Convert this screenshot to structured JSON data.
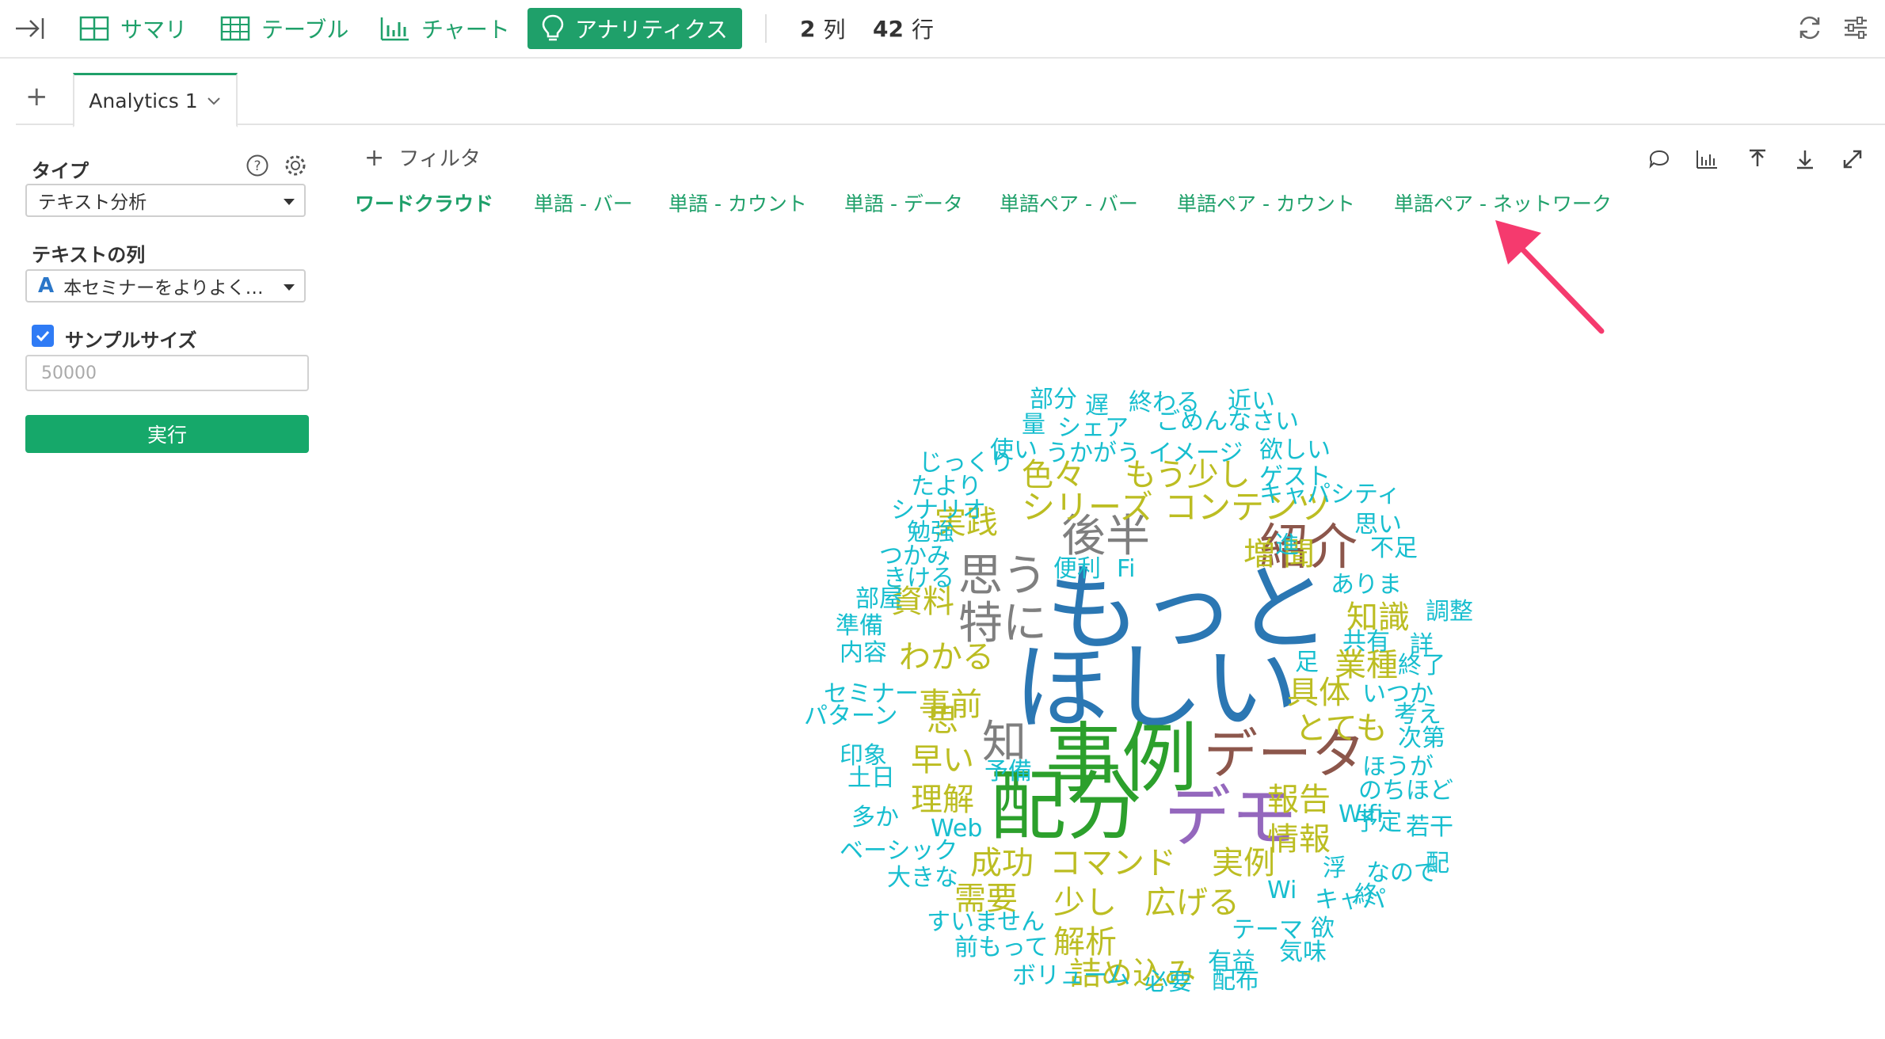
{
  "toolbar": {
    "items": [
      {
        "label": "サマリ",
        "icon": "summary-grid-icon"
      },
      {
        "label": "テーブル",
        "icon": "table-icon"
      },
      {
        "label": "チャート",
        "icon": "bar-chart-icon"
      },
      {
        "label": "アナリティクス",
        "icon": "lightbulb-icon"
      }
    ],
    "columns_count": "2",
    "columns_unit": "列",
    "rows_count": "42",
    "rows_unit": "行"
  },
  "tabs": {
    "add": "+",
    "active_tab": "Analytics 1"
  },
  "panel": {
    "type_label": "タイプ",
    "type_value": "テキスト分析",
    "text_col_label": "テキストの列",
    "text_col_value": "本セミナーをよりよく…",
    "text_col_icon_glyph": "A",
    "sample_label": "サンプルサイズ",
    "sample_placeholder": "50000",
    "run_label": "実行"
  },
  "main": {
    "filter_label": "フィルタ",
    "subtabs": [
      "ワードクラウド",
      "単語 - バー",
      "単語 - カウント",
      "単語 - データ",
      "単語ペア - バー",
      "単語ペア - カウント",
      "単語ペア - ネットワーク"
    ]
  },
  "colors": {
    "accent": "#1fa06a",
    "arrow": "#f53a6e"
  },
  "words": [
    {
      "t": "もっと",
      "c": "#2b77b3",
      "s": 120
    },
    {
      "t": "ほしい",
      "c": "#2b77b3",
      "s": 120
    },
    {
      "t": "事例",
      "c": "#2ca02c",
      "s": 96
    },
    {
      "t": "配分",
      "c": "#2ca02c",
      "s": 96
    },
    {
      "t": "デモ",
      "c": "#9467bd",
      "s": 84
    },
    {
      "t": "データ",
      "c": "#8c564b",
      "s": 68
    },
    {
      "t": "紹介",
      "c": "#8c564b",
      "s": 62
    },
    {
      "t": "後半",
      "c": "#7f7f7f",
      "s": 56
    },
    {
      "t": "思う",
      "c": "#7f7f7f",
      "s": 56
    },
    {
      "t": "特に",
      "c": "#7f7f7f",
      "s": 56
    },
    {
      "t": "知",
      "c": "#7f7f7f",
      "s": 56
    },
    {
      "t": "シリーズ",
      "c": "#bcbd22",
      "s": 42
    },
    {
      "t": "コンテンツ",
      "c": "#bcbd22",
      "s": 42
    },
    {
      "t": "もう少し",
      "c": "#bcbd22",
      "s": 40
    },
    {
      "t": "色々",
      "c": "#bcbd22",
      "s": 40
    },
    {
      "t": "実践",
      "c": "#bcbd22",
      "s": 40
    },
    {
      "t": "資料",
      "c": "#bcbd22",
      "s": 40
    },
    {
      "t": "わかる",
      "c": "#bcbd22",
      "s": 40
    },
    {
      "t": "事前",
      "c": "#bcbd22",
      "s": 40
    },
    {
      "t": "思",
      "c": "#bcbd22",
      "s": 40
    },
    {
      "t": "早い",
      "c": "#bcbd22",
      "s": 40
    },
    {
      "t": "理解",
      "c": "#bcbd22",
      "s": 40
    },
    {
      "t": "増",
      "c": "#bcbd22",
      "s": 40
    },
    {
      "t": "聞",
      "c": "#bcbd22",
      "s": 40
    },
    {
      "t": "知識",
      "c": "#bcbd22",
      "s": 40
    },
    {
      "t": "業種",
      "c": "#bcbd22",
      "s": 40
    },
    {
      "t": "具体",
      "c": "#bcbd22",
      "s": 40
    },
    {
      "t": "とても",
      "c": "#bcbd22",
      "s": 40
    },
    {
      "t": "報告",
      "c": "#bcbd22",
      "s": 40
    },
    {
      "t": "情報",
      "c": "#bcbd22",
      "s": 40
    },
    {
      "t": "成功",
      "c": "#bcbd22",
      "s": 40
    },
    {
      "t": "コマンド",
      "c": "#bcbd22",
      "s": 40
    },
    {
      "t": "実例",
      "c": "#bcbd22",
      "s": 40
    },
    {
      "t": "需要",
      "c": "#bcbd22",
      "s": 40
    },
    {
      "t": "少し",
      "c": "#bcbd22",
      "s": 40
    },
    {
      "t": "広げる",
      "c": "#bcbd22",
      "s": 40
    },
    {
      "t": "解析",
      "c": "#bcbd22",
      "s": 40
    },
    {
      "t": "詰め込み",
      "c": "#bcbd22",
      "s": 40
    },
    {
      "t": "部分",
      "c": "#17becf",
      "s": 30
    },
    {
      "t": "遅",
      "c": "#17becf",
      "s": 30
    },
    {
      "t": "終わる",
      "c": "#17becf",
      "s": 30
    },
    {
      "t": "近い",
      "c": "#17becf",
      "s": 30
    },
    {
      "t": "量",
      "c": "#17becf",
      "s": 30
    },
    {
      "t": "シェア",
      "c": "#17becf",
      "s": 30
    },
    {
      "t": "ごめんなさい",
      "c": "#17becf",
      "s": 30
    },
    {
      "t": "使い",
      "c": "#17becf",
      "s": 30
    },
    {
      "t": "うかがう",
      "c": "#17becf",
      "s": 30
    },
    {
      "t": "イメージ",
      "c": "#17becf",
      "s": 30
    },
    {
      "t": "欲しい",
      "c": "#17becf",
      "s": 30
    },
    {
      "t": "じっくり",
      "c": "#17becf",
      "s": 30
    },
    {
      "t": "ゲスト",
      "c": "#17becf",
      "s": 30
    },
    {
      "t": "たより",
      "c": "#17becf",
      "s": 30
    },
    {
      "t": "キャパシティ",
      "c": "#17becf",
      "s": 30
    },
    {
      "t": "シナリオ",
      "c": "#17becf",
      "s": 30
    },
    {
      "t": "思い",
      "c": "#17becf",
      "s": 30
    },
    {
      "t": "勉強",
      "c": "#17becf",
      "s": 30
    },
    {
      "t": "進",
      "c": "#17becf",
      "s": 30
    },
    {
      "t": "不足",
      "c": "#17becf",
      "s": 30
    },
    {
      "t": "つかみ",
      "c": "#17becf",
      "s": 30
    },
    {
      "t": "便利",
      "c": "#17becf",
      "s": 30
    },
    {
      "t": "Fi",
      "c": "#17becf",
      "s": 30
    },
    {
      "t": "きける",
      "c": "#17becf",
      "s": 30
    },
    {
      "t": "ありま",
      "c": "#17becf",
      "s": 30
    },
    {
      "t": "部屋",
      "c": "#17becf",
      "s": 30
    },
    {
      "t": "調整",
      "c": "#17becf",
      "s": 30
    },
    {
      "t": "準備",
      "c": "#17becf",
      "s": 30
    },
    {
      "t": "共有",
      "c": "#17becf",
      "s": 30
    },
    {
      "t": "詳",
      "c": "#17becf",
      "s": 30
    },
    {
      "t": "内容",
      "c": "#17becf",
      "s": 30
    },
    {
      "t": "足",
      "c": "#17becf",
      "s": 30
    },
    {
      "t": "終了",
      "c": "#17becf",
      "s": 30
    },
    {
      "t": "セミナー",
      "c": "#17becf",
      "s": 30
    },
    {
      "t": "いつか",
      "c": "#17becf",
      "s": 30
    },
    {
      "t": "パターン",
      "c": "#17becf",
      "s": 30
    },
    {
      "t": "考え",
      "c": "#17becf",
      "s": 30
    },
    {
      "t": "次第",
      "c": "#17becf",
      "s": 30
    },
    {
      "t": "印象",
      "c": "#17becf",
      "s": 30
    },
    {
      "t": "予備",
      "c": "#17becf",
      "s": 30
    },
    {
      "t": "ほうが",
      "c": "#17becf",
      "s": 30
    },
    {
      "t": "土日",
      "c": "#17becf",
      "s": 30
    },
    {
      "t": "のちほど",
      "c": "#17becf",
      "s": 30
    },
    {
      "t": "多か",
      "c": "#17becf",
      "s": 30
    },
    {
      "t": "Web",
      "c": "#17becf",
      "s": 30
    },
    {
      "t": "Wifi",
      "c": "#17becf",
      "s": 30
    },
    {
      "t": "予定",
      "c": "#17becf",
      "s": 30
    },
    {
      "t": "若干",
      "c": "#17becf",
      "s": 30
    },
    {
      "t": "ベーシック",
      "c": "#17becf",
      "s": 30
    },
    {
      "t": "浮",
      "c": "#17becf",
      "s": 30
    },
    {
      "t": "なので",
      "c": "#17becf",
      "s": 30
    },
    {
      "t": "配",
      "c": "#17becf",
      "s": 30
    },
    {
      "t": "大きな",
      "c": "#17becf",
      "s": 30
    },
    {
      "t": "Wi",
      "c": "#17becf",
      "s": 30
    },
    {
      "t": "キャパ",
      "c": "#17becf",
      "s": 30
    },
    {
      "t": "終",
      "c": "#17becf",
      "s": 30
    },
    {
      "t": "すいません",
      "c": "#17becf",
      "s": 30
    },
    {
      "t": "テーマ",
      "c": "#17becf",
      "s": 30
    },
    {
      "t": "欲",
      "c": "#17becf",
      "s": 30
    },
    {
      "t": "前もって",
      "c": "#17becf",
      "s": 30
    },
    {
      "t": "有益",
      "c": "#17becf",
      "s": 30
    },
    {
      "t": "気味",
      "c": "#17becf",
      "s": 30
    },
    {
      "t": "ボリューム",
      "c": "#17becf",
      "s": 30
    },
    {
      "t": "必要",
      "c": "#17becf",
      "s": 30
    },
    {
      "t": "配布",
      "c": "#17becf",
      "s": 30
    }
  ]
}
